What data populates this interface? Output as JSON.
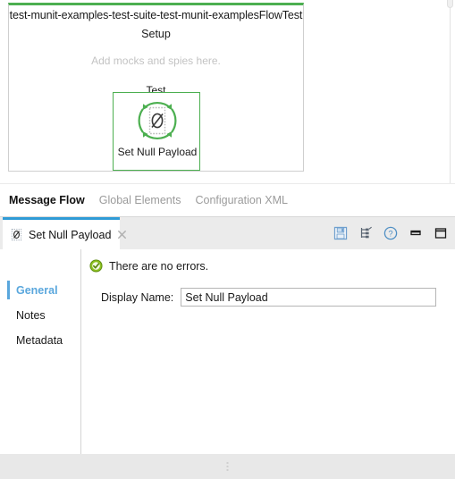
{
  "flow": {
    "title": "test-munit-examples-test-suite-test-munit-examplesFlowTest",
    "setup_label": "Setup",
    "mocks_hint": "Add mocks and spies here.",
    "test_label": "Test",
    "node_label": "Set Null Payload",
    "node_icon": "set-null-payload-icon",
    "accent_color": "#4caf50"
  },
  "editor_tabs": [
    {
      "label": "Message Flow",
      "active": true
    },
    {
      "label": "Global Elements",
      "active": false
    },
    {
      "label": "Configuration XML",
      "active": false
    }
  ],
  "properties": {
    "tab": {
      "label": "Set Null Payload",
      "icon": "set-null-payload-icon",
      "close_icon": "close-icon",
      "accent_color": "#2f9bd6"
    },
    "toolbar": [
      {
        "name": "save-icon",
        "title": "Save"
      },
      {
        "name": "outline-tree-icon",
        "title": "Outline"
      },
      {
        "name": "help-icon",
        "title": "Help"
      },
      {
        "name": "minimize-icon",
        "title": "Minimize"
      },
      {
        "name": "maximize-icon",
        "title": "Maximize"
      }
    ],
    "side_nav": [
      {
        "label": "General",
        "active": true
      },
      {
        "label": "Notes",
        "active": false
      },
      {
        "label": "Metadata",
        "active": false
      }
    ],
    "status": {
      "icon": "success-check-icon",
      "text": "There are no errors.",
      "color": "#7cb518"
    },
    "fields": [
      {
        "label": "Display Name:",
        "value": "Set Null Payload",
        "placeholder": ""
      }
    ]
  }
}
